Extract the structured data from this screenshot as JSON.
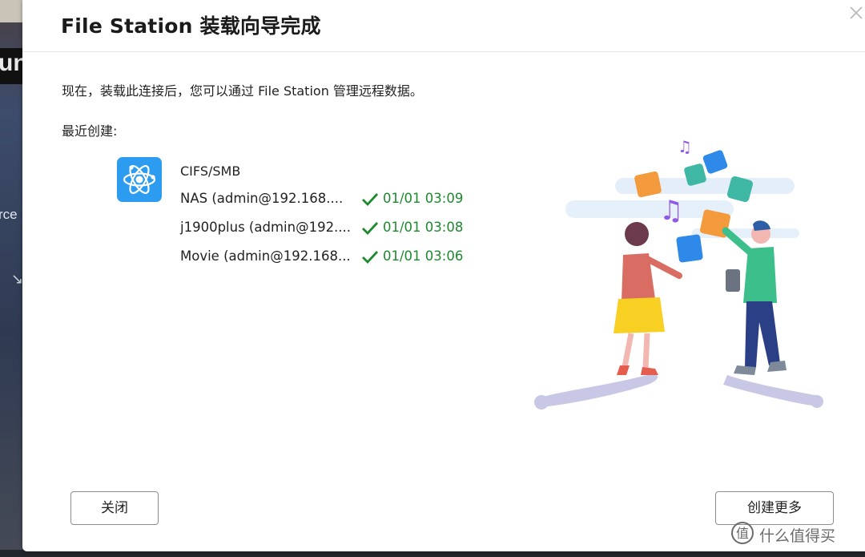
{
  "background": {
    "fragment_top": "un",
    "fragment_side": "rce"
  },
  "dialog": {
    "title": "File Station 装载向导完成",
    "description": "现在，装载此连接后，您可以通过 File Station 管理远程数据。",
    "recent_label": "最近创建:",
    "protocol": "CIFS/SMB",
    "connections": [
      {
        "name": "NAS (admin@192.168....",
        "time": "01/01 03:09",
        "status": "success"
      },
      {
        "name": "j1900plus (admin@192....",
        "time": "01/01 03:08",
        "status": "success"
      },
      {
        "name": "Movie (admin@192.168...",
        "time": "01/01 03:06",
        "status": "success"
      }
    ],
    "buttons": {
      "close": "关闭",
      "create_more": "创建更多"
    }
  },
  "watermark": {
    "text": "什么值得买",
    "logo": "值"
  },
  "colors": {
    "accent_blue": "#2c9cf0",
    "success_green": "#1e8a2e"
  },
  "icons": {
    "app": "cifs-smb-icon",
    "status": "check-icon",
    "close": "close-icon"
  }
}
